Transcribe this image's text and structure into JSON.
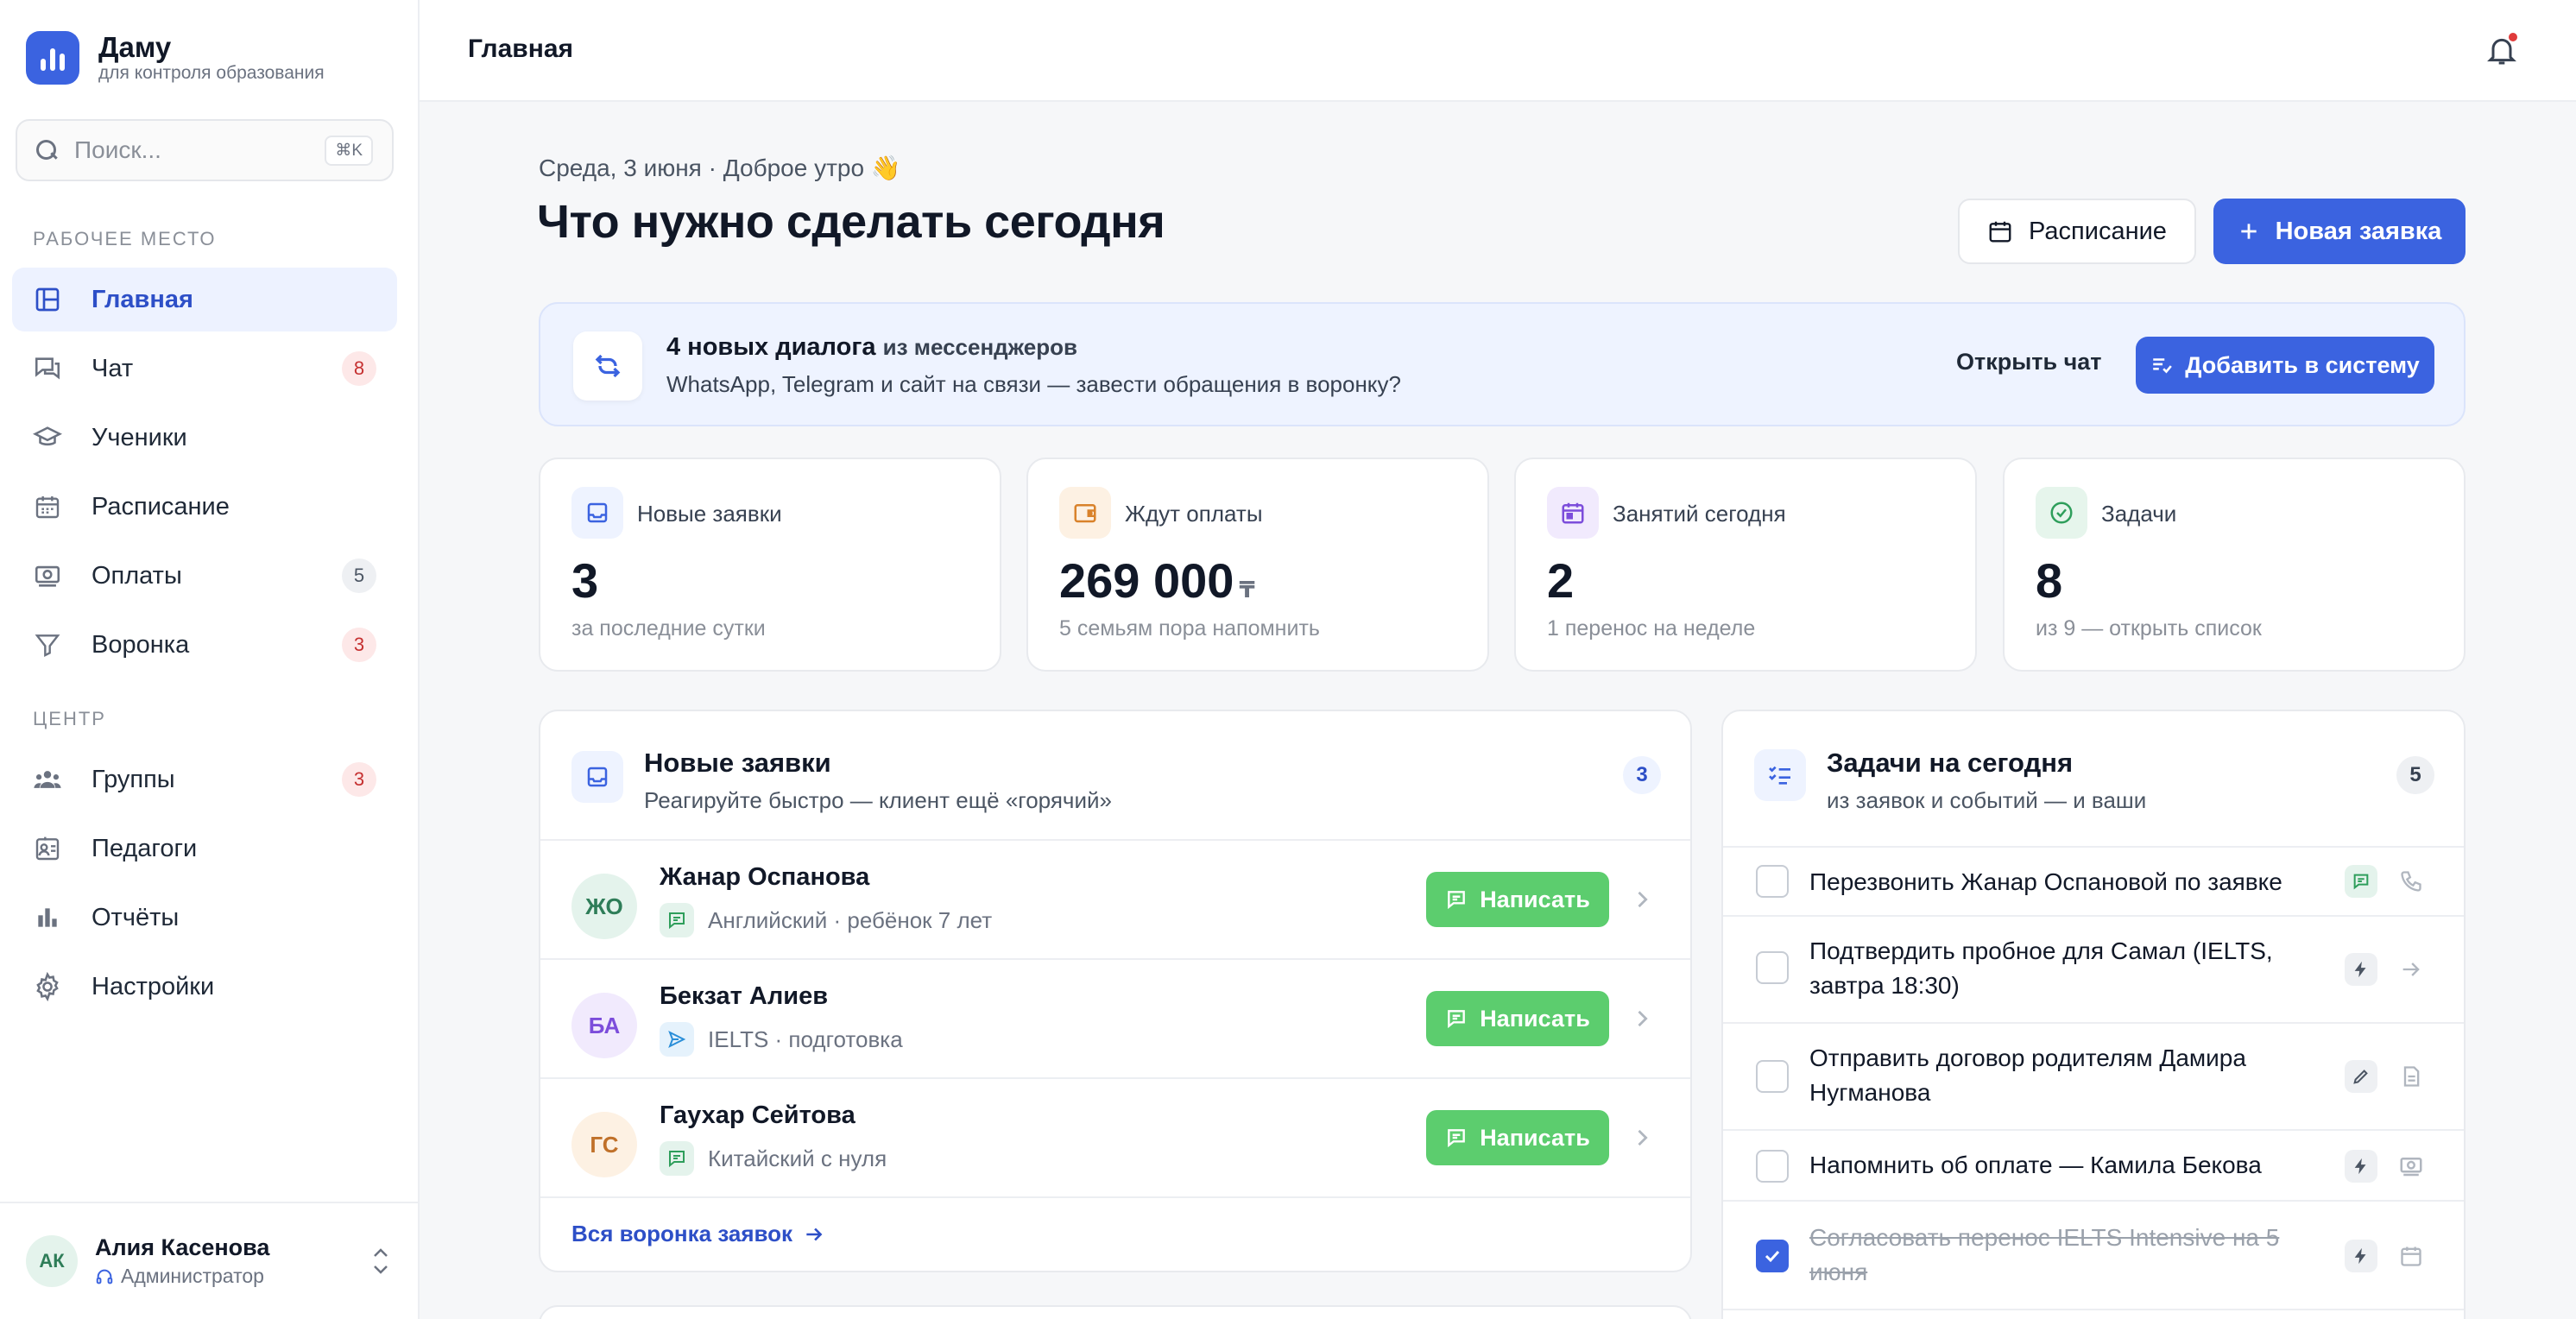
{
  "brand": {
    "name": "Даму",
    "subtitle": "для контроля образования"
  },
  "search": {
    "placeholder": "Поиск...",
    "shortcut": "⌘K"
  },
  "sidebar": {
    "section_workspace": "РАБОЧЕЕ МЕСТО",
    "section_center": "ЦЕНТР",
    "items": [
      {
        "label": "Главная",
        "icon": "dashboard-icon",
        "active": true
      },
      {
        "label": "Чат",
        "icon": "chat-icon",
        "badge": "8"
      },
      {
        "label": "Ученики",
        "icon": "graduation-cap-icon"
      },
      {
        "label": "Расписание",
        "icon": "calendar-icon"
      },
      {
        "label": "Оплаты",
        "icon": "payments-icon",
        "badge": "5"
      },
      {
        "label": "Воронка",
        "icon": "funnel-icon",
        "badge": "3"
      },
      {
        "label": "Группы",
        "icon": "groups-icon",
        "badge": "3"
      },
      {
        "label": "Педагоги",
        "icon": "teacher-badge-icon"
      },
      {
        "label": "Отчёты",
        "icon": "bar-chart-icon"
      },
      {
        "label": "Настройки",
        "icon": "gear-icon"
      }
    ]
  },
  "user": {
    "initials": "АК",
    "name": "Алия Касенова",
    "role": "Администратор"
  },
  "topbar": {
    "title": "Главная"
  },
  "header": {
    "greeting": "Среда, 3 июня · Доброе утро 👋",
    "title": "Что нужно сделать сегодня",
    "schedule_button": "Расписание",
    "new_request_button": "Новая заявка"
  },
  "banner": {
    "title_bold": "4 новых диалога",
    "title_rest": "из мессенджеров",
    "subtitle": "WhatsApp, Telegram и сайт на связи — завести обращения в воронку?",
    "open_chat": "Открыть чат",
    "add_button": "Добавить в систему"
  },
  "stats": [
    {
      "label": "Новые заявки",
      "value": "3",
      "currency": "",
      "sub": "за последние сутки",
      "color": "#3b63e0"
    },
    {
      "label": "Ждут оплаты",
      "value": "269 000",
      "currency": "₸",
      "sub": "5 семьям пора напомнить",
      "color": "#d9822b"
    },
    {
      "label": "Занятий сегодня",
      "value": "2",
      "currency": "",
      "sub": "1 перенос на неделе",
      "color": "#7c4ddb"
    },
    {
      "label": "Задачи",
      "value": "8",
      "currency": "",
      "sub": "из 9 — открыть список",
      "color": "#2e9e5b"
    }
  ],
  "leads_card": {
    "title": "Новые заявки",
    "subtitle": "Реагируйте быстро — клиент ещё «горячий»",
    "count": "3",
    "write_label": "Написать",
    "footer_link": "Вся воронка заявок",
    "leads": [
      {
        "initials": "ЖО",
        "name": "Жанар Оспанова",
        "meta": "Английский · ребёнок 7 лет",
        "channel": "whatsapp-icon"
      },
      {
        "initials": "БА",
        "name": "Бекзат Алиев",
        "meta": "IELTS · подготовка",
        "channel": "telegram-icon"
      },
      {
        "initials": "ГС",
        "name": "Гаухар Сейтова",
        "meta": "Китайский с нуля",
        "channel": "whatsapp-icon"
      }
    ]
  },
  "tasks_card": {
    "title": "Задачи на сегодня",
    "subtitle": "из заявок и событий — и ваши",
    "count": "5",
    "tasks": [
      {
        "text": "Перезвонить Жанар Оспановой по заявке",
        "done": false
      },
      {
        "text": "Подтвердить пробное для Самал (IELTS, завтра 18:30)",
        "done": false
      },
      {
        "text": "Отправить договор родителям Дамира Нугманова",
        "done": false
      },
      {
        "text": "Напомнить об оплате — Камила Бекова",
        "done": false
      },
      {
        "text": "Согласовать перенос IELTS Intensive на 5 июня",
        "done": true
      }
    ]
  }
}
